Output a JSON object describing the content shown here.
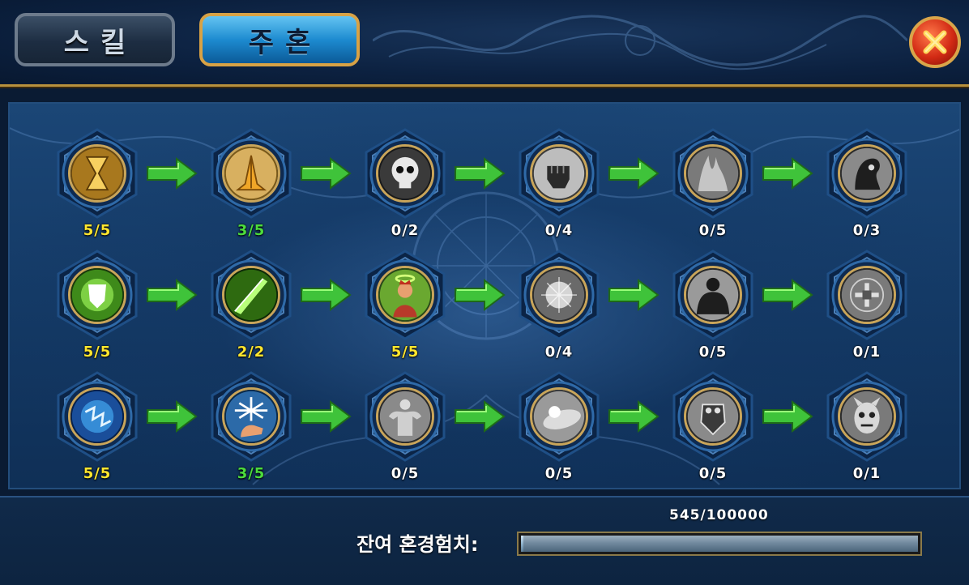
{
  "tabs": [
    {
      "label": "스킬",
      "active": false
    },
    {
      "label": "주혼",
      "active": true
    }
  ],
  "close_icon": "close-x-icon",
  "skill_tree": {
    "rows": [
      [
        {
          "icon": "hourglass-icon",
          "level": "5/5",
          "color": "#ffe62e"
        },
        {
          "icon": "praying-hands-icon",
          "level": "3/5",
          "color": "#4cdc3c"
        },
        {
          "icon": "skull-icon",
          "level": "0/2",
          "color": "#ffffff"
        },
        {
          "icon": "fist-icon",
          "level": "0/4",
          "color": "#ffffff"
        },
        {
          "icon": "mist-icon",
          "level": "0/5",
          "color": "#ffffff"
        },
        {
          "icon": "reaper-icon",
          "level": "0/3",
          "color": "#ffffff"
        }
      ],
      [
        {
          "icon": "glowing-shield-icon",
          "level": "5/5",
          "color": "#ffe62e"
        },
        {
          "icon": "green-blade-icon",
          "level": "2/2",
          "color": "#ffe62e"
        },
        {
          "icon": "haloed-warrior-icon",
          "level": "5/5",
          "color": "#ffe62e"
        },
        {
          "icon": "energy-orb-icon",
          "level": "0/4",
          "color": "#ffffff"
        },
        {
          "icon": "dark-giant-icon",
          "level": "0/5",
          "color": "#ffffff"
        },
        {
          "icon": "cross-seal-icon",
          "level": "0/1",
          "color": "#ffffff"
        }
      ],
      [
        {
          "icon": "blue-rune-icon",
          "level": "5/5",
          "color": "#ffe62e"
        },
        {
          "icon": "frost-hand-icon",
          "level": "3/5",
          "color": "#4cdc3c"
        },
        {
          "icon": "muscle-figure-icon",
          "level": "0/5",
          "color": "#ffffff"
        },
        {
          "icon": "light-burst-icon",
          "level": "0/5",
          "color": "#ffffff"
        },
        {
          "icon": "armor-crest-icon",
          "level": "0/5",
          "color": "#ffffff"
        },
        {
          "icon": "demon-face-icon",
          "level": "0/1",
          "color": "#ffffff"
        }
      ]
    ],
    "arrow_color": "#3fc33a"
  },
  "exp": {
    "label": "잔여 혼경험치:",
    "value_text": "545/100000",
    "fraction": 0.00545
  }
}
